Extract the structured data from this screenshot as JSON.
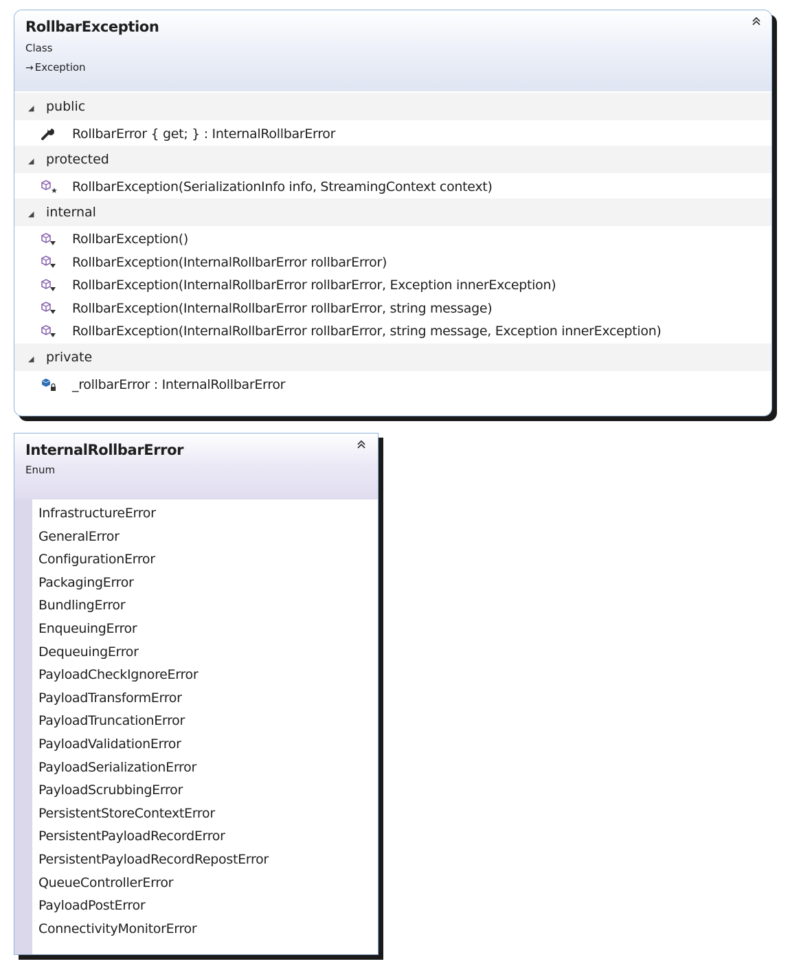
{
  "class_box": {
    "title": "RollbarException",
    "kind": "Class",
    "base": "Exception",
    "collapse_icon": "double-chevron-up-icon",
    "sections": [
      {
        "label": "public",
        "members": [
          {
            "icon": "property-wrench-icon",
            "text": "RollbarError { get; } : InternalRollbarError"
          }
        ]
      },
      {
        "label": "protected",
        "members": [
          {
            "icon": "protected-method-icon",
            "text": "RollbarException(SerializationInfo info, StreamingContext context)"
          }
        ]
      },
      {
        "label": "internal",
        "members": [
          {
            "icon": "internal-method-icon",
            "text": "RollbarException()"
          },
          {
            "icon": "internal-method-icon",
            "text": "RollbarException(InternalRollbarError rollbarError)"
          },
          {
            "icon": "internal-method-icon",
            "text": "RollbarException(InternalRollbarError rollbarError, Exception innerException)"
          },
          {
            "icon": "internal-method-icon",
            "text": "RollbarException(InternalRollbarError rollbarError, string message)"
          },
          {
            "icon": "internal-method-icon",
            "text": "RollbarException(InternalRollbarError rollbarError, string message, Exception innerException)"
          }
        ]
      },
      {
        "label": "private",
        "members": [
          {
            "icon": "private-field-icon",
            "text": "_rollbarError : InternalRollbarError"
          }
        ]
      }
    ]
  },
  "enum_box": {
    "title": "InternalRollbarError",
    "kind": "Enum",
    "collapse_icon": "double-chevron-up-icon",
    "values": [
      "InfrastructureError",
      "GeneralError",
      "ConfigurationError",
      "PackagingError",
      "BundlingError",
      "EnqueuingError",
      "DequeuingError",
      "PayloadCheckIgnoreError",
      "PayloadTransformError",
      "PayloadTruncationError",
      "PayloadValidationError",
      "PayloadSerializationError",
      "PayloadScrubbingError",
      "PersistentStoreContextError",
      "PersistentPayloadRecordError",
      "PersistentPayloadRecordRepostError",
      "QueueControllerError",
      "PayloadPostError",
      "ConnectivityMonitorError"
    ]
  },
  "colors": {
    "class_header": "#dfe5f2",
    "enum_header": "#e0dcef",
    "border": "#8fb3d9",
    "shadow": "#1a1a1a",
    "member_icon_purple": "#8a63b0"
  }
}
